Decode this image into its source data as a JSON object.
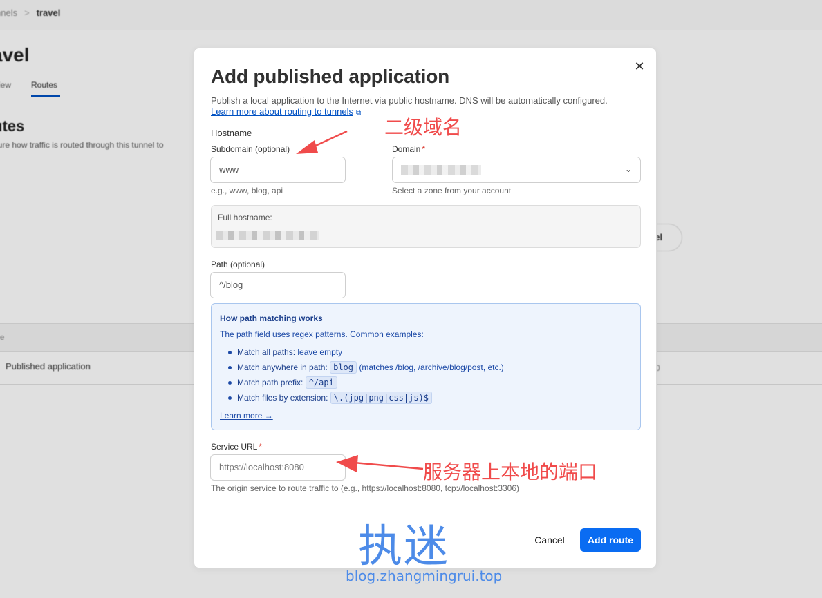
{
  "background": {
    "breadcrumb_prev": "nnels",
    "breadcrumb_sep": ">",
    "breadcrumb_current": "travel",
    "page_title": "avel",
    "tab_overview": "view",
    "tab_routes": "Routes",
    "section_title": "utes",
    "section_desc": "gure how traffic is routed through this tunnel to",
    "pill_label": "vel",
    "table_header": "pe",
    "row_type": "Published application",
    "row_right": "0"
  },
  "modal": {
    "title": "Add published application",
    "subtitle": "Publish a local application to the Internet via public hostname. DNS will be automatically configured.",
    "learn_link": "Learn more about routing to tunnels",
    "close_icon": "close-icon",
    "hostname_label": "Hostname",
    "subdomain_label": "Subdomain (optional)",
    "subdomain_value": "www",
    "subdomain_hint": "e.g., www, blog, api",
    "domain_label": "Domain",
    "domain_required": "*",
    "domain_hint": "Select a zone from your account",
    "full_hostname_label": "Full hostname:",
    "path_label": "Path (optional)",
    "path_value": "^/blog",
    "info": {
      "heading": "How path matching works",
      "intro": "The path field uses regex patterns. Common examples:",
      "items": [
        {
          "key": "Match all paths:",
          "text": "leave empty"
        },
        {
          "key": "Match anywhere in path:",
          "code": "blog",
          "text": "(matches /blog, /archive/blog/post, etc.)"
        },
        {
          "key": "Match path prefix:",
          "code": "^/api"
        },
        {
          "key": "Match files by extension:",
          "code": "\\.(jpg|png|css|js)$"
        }
      ],
      "learn_more": "Learn more →"
    },
    "service_label": "Service URL",
    "service_required": "*",
    "service_placeholder": "https://localhost:8080",
    "service_hint": "The origin service to route traffic to (e.g., https://localhost:8080, tcp://localhost:3306)",
    "cancel_label": "Cancel",
    "add_label": "Add route"
  },
  "annotations": {
    "subdomain_note": "二级域名",
    "service_note": "服务器上本地的端口",
    "watermark_title": "执迷",
    "watermark_url": "blog.zhangmingrui.top",
    "arrow_color": "#f04b4b"
  }
}
